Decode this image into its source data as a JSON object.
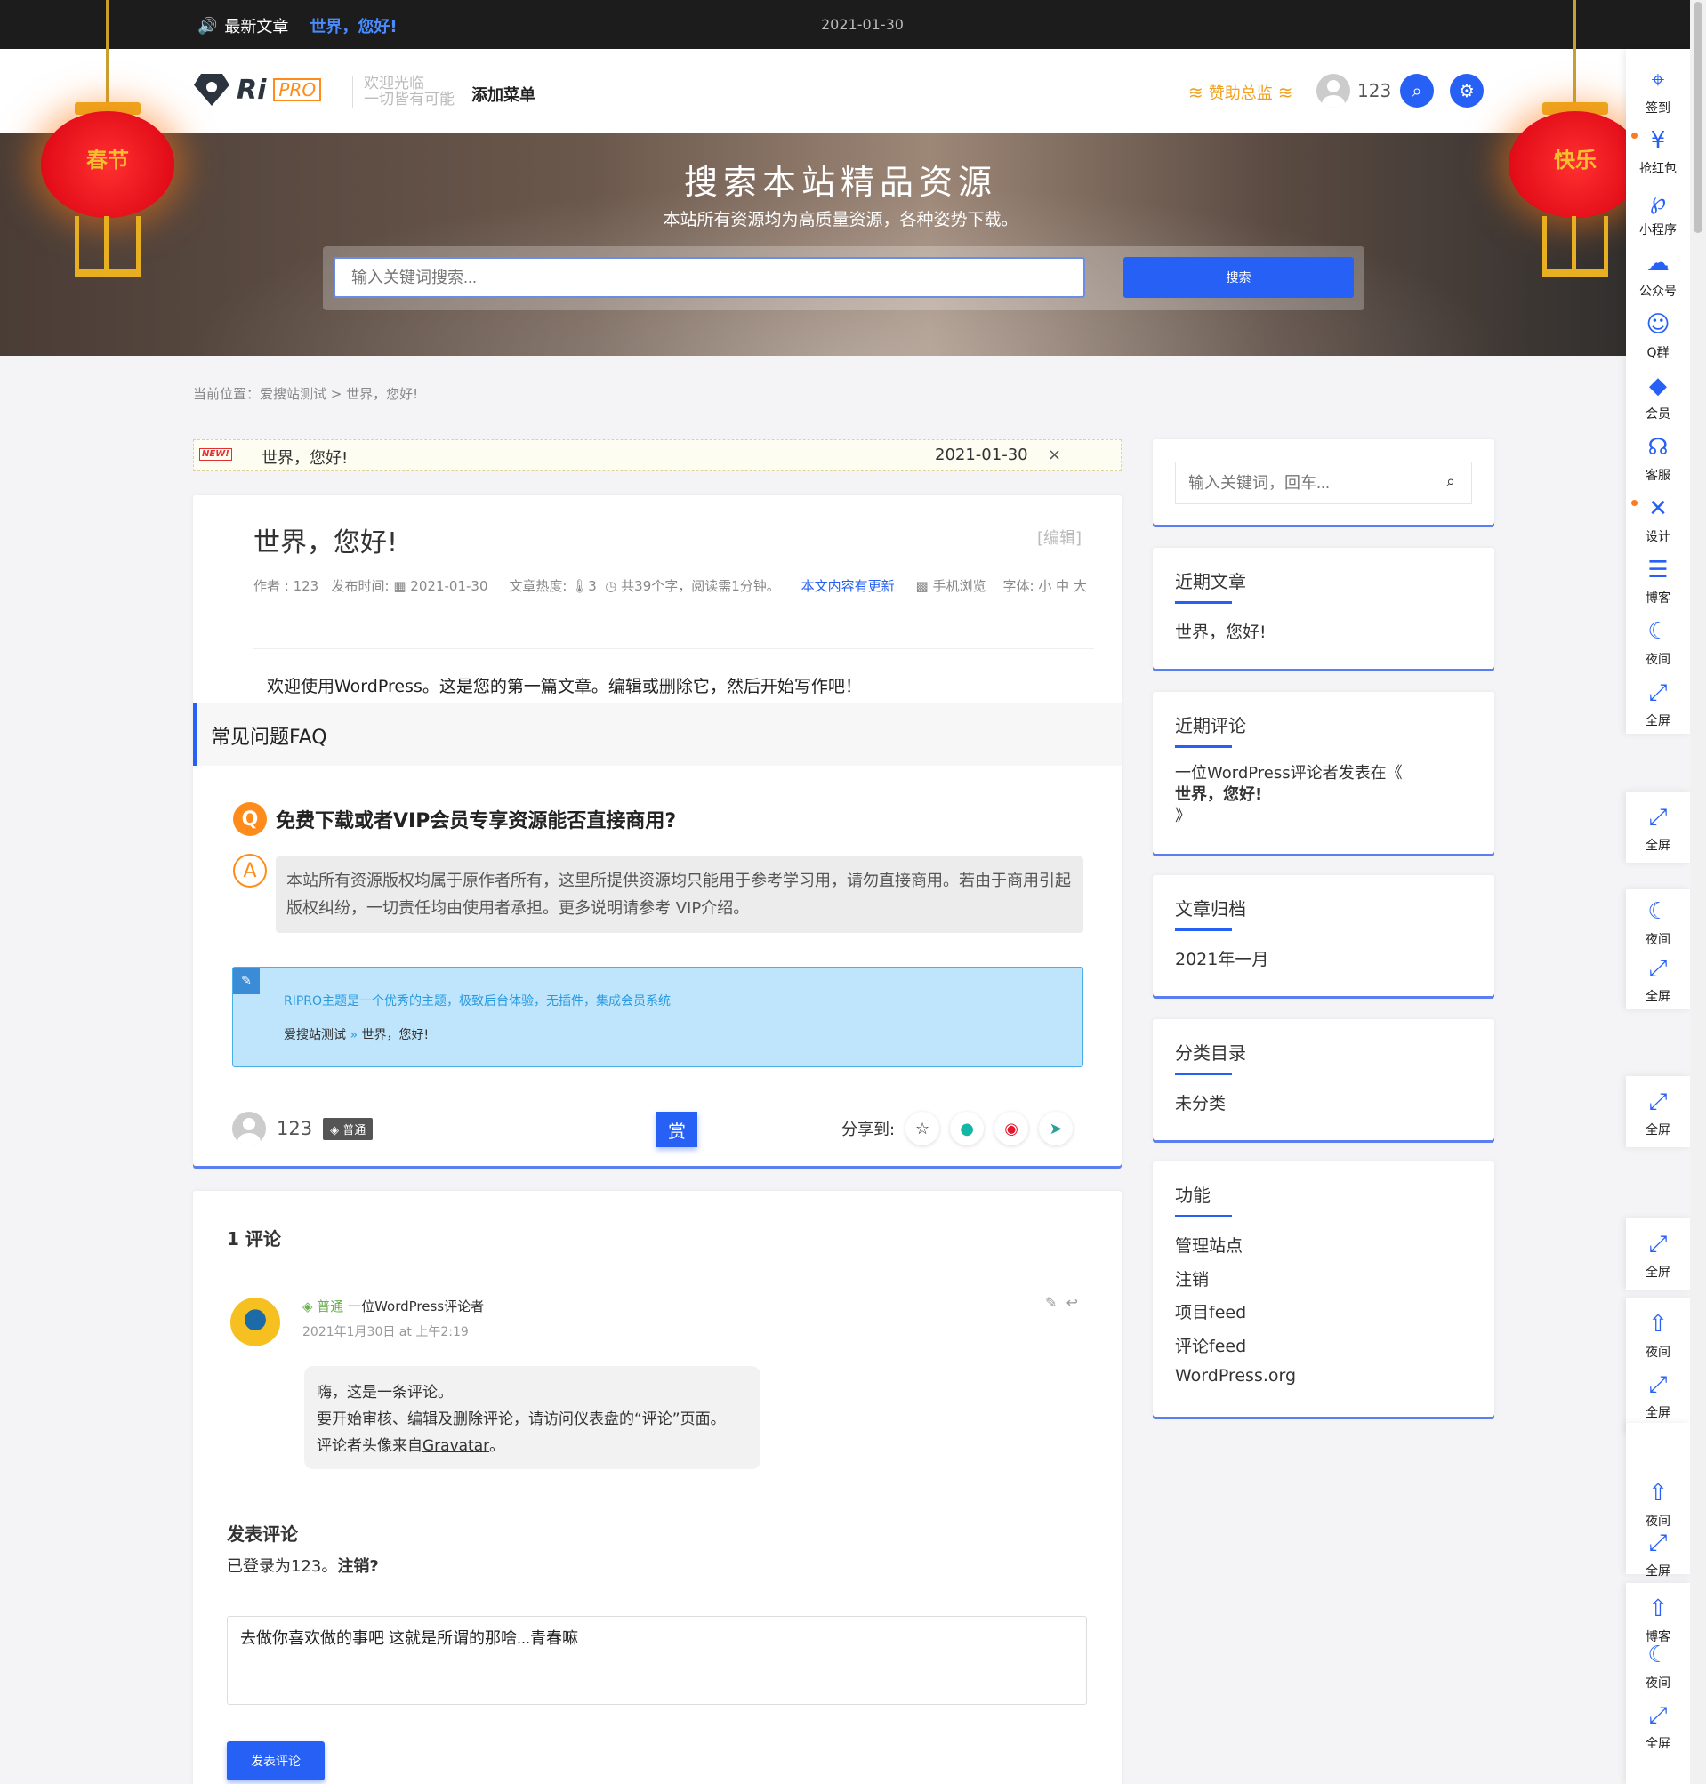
{
  "topbar": {
    "notice_label": "最新文章",
    "notice_title": "世界，您好!",
    "date": "2021-01-30"
  },
  "header": {
    "logo_ri": "Ri",
    "logo_pro": "PRO",
    "slogan_line1": "欢迎光临",
    "slogan_line2": "一切皆有可能",
    "add_menu": "添加菜单",
    "sponsor": "赞助总监",
    "username": "123"
  },
  "hero": {
    "title": "搜索本站精品资源",
    "subtitle": "本站所有资源均为高质量资源，各种姿势下载。",
    "search_placeholder": "输入关键词搜索...",
    "search_button": "搜索",
    "lantern_left": "春节",
    "lantern_right": "快乐"
  },
  "breadcrumb": "当前位置：爱搜站测试 > 世界，您好!",
  "newbar": {
    "tag": "NEW!",
    "title": "世界，您好!",
    "date": "2021-01-30",
    "close": "×"
  },
  "post": {
    "title": "世界，您好!",
    "edit": "[编辑]",
    "meta_author": "作者 : 123",
    "meta_date": "发布时间: ▦ 2021-01-30",
    "meta_heat": "文章热度: 🌡3",
    "meta_words": "◷ 共39个字，阅读需1分钟。",
    "meta_updated": "本文内容有更新",
    "meta_mobile": "▩ 手机浏览",
    "meta_font": "字体: 小 中 大",
    "lead": "欢迎使用WordPress。这是您的第一篇文章。编辑或删除它，然后开始写作吧！",
    "faq_heading": "常见问题FAQ",
    "faq_q": "免费下载或者VIP会员专享资源能否直接商用?",
    "faq_a": "本站所有资源版权均属于原作者所有，这里所提供资源均只能用于参考学习用，请勿直接商用。若由于商用引起版权纠纷，一切责任均由使用者承担。更多说明请参考 VIP介绍。",
    "info_line1": "RIPRO主题是一个优秀的主题，极致后台体验，无插件，集成会员系统",
    "info_crumb_site": "爱搜站测试",
    "info_crumb_arrow": "»",
    "info_crumb_post": "世界，您好!",
    "author_name": "123",
    "author_badge": "◈ 普通",
    "reward_btn": "赏",
    "share_label": "分享到:"
  },
  "comments": {
    "title": "1 评论",
    "level": "◈ 普通",
    "commenter": "一位WordPress评论者",
    "time": "2021年1月30日 at 上午2:19",
    "body_line1": "嗨，这是一条评论。",
    "body_line2": "要开始审核、编辑及删除评论，请访问仪表盘的“评论”页面。",
    "body_line3_pre": "评论者头像来自",
    "body_line3_link": "Gravatar",
    "body_line3_post": "。",
    "form_title": "发表评论",
    "logged_in_pre": "已登录为123。",
    "logged_in_logout": "注销?",
    "textarea_value": "去做你喜欢做的事吧 这就是所谓的那啥...青春嘛",
    "submit": "发表评论"
  },
  "sidebar": {
    "search_placeholder": "输入关键词，回车...",
    "recent_posts_title": "近期文章",
    "recent_posts": [
      "世界，您好!"
    ],
    "recent_comments_title": "近期评论",
    "recent_comment_pre": "一位WordPress评论者发表在《",
    "recent_comment_post": "世界，您好!",
    "recent_comment_close": "》",
    "archives_title": "文章归档",
    "archives": [
      "2021年一月"
    ],
    "categories_title": "分类目录",
    "categories": [
      "未分类"
    ],
    "meta_title": "功能",
    "meta_links": [
      "管理站点",
      "注销",
      "项目feed",
      "评论feed",
      "WordPress.org"
    ]
  },
  "rightbar": {
    "items": [
      "签到",
      "抢红包",
      "小程序",
      "公众号",
      "Q群",
      "会员",
      "客服",
      "设计",
      "博客",
      "夜间",
      "全屏"
    ],
    "ghost_labels": [
      "全屏",
      "夜间",
      "全屏",
      "全屏",
      "全屏",
      "夜间",
      "全屏",
      "夜间",
      "全屏",
      "博客",
      "夜间",
      "全屏"
    ]
  },
  "colors": {
    "accent": "#2660f5",
    "orange": "#ff8c1a",
    "topbar": "#1c1c1c"
  }
}
